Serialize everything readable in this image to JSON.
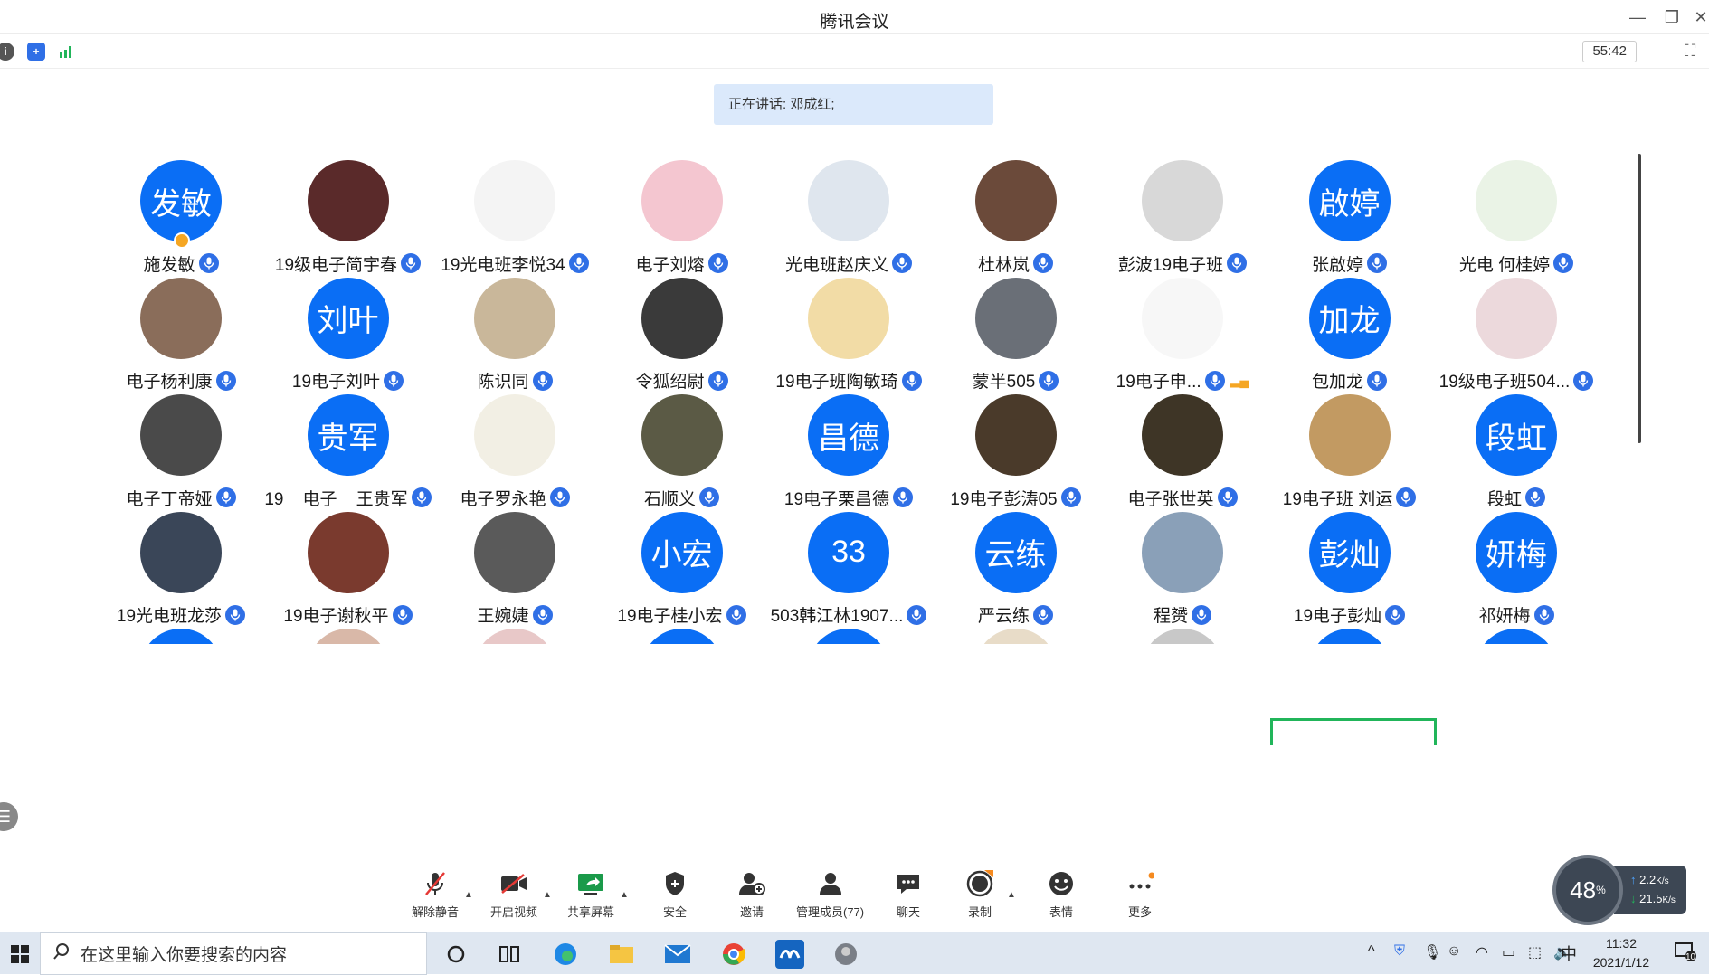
{
  "window": {
    "title": "腾讯会议"
  },
  "toolbar": {
    "timer": "55:42"
  },
  "speaking": {
    "text": "正在讲话: 邓成红;"
  },
  "participants": [
    {
      "name": "施发敏",
      "avatar_text": "发敏",
      "type": "text",
      "host": true
    },
    {
      "name": "19级电子简宇春",
      "type": "photo",
      "color": "#5a2a2a"
    },
    {
      "name": "19光电班李悦34",
      "type": "photo",
      "color": "#f4f4f4"
    },
    {
      "name": "电子刘熔",
      "type": "photo",
      "color": "#f4c6d0"
    },
    {
      "name": "光电班赵庆义",
      "type": "photo",
      "color": "#dfe6ee"
    },
    {
      "name": "杜林岚",
      "type": "photo",
      "color": "#6b4a3a"
    },
    {
      "name": "彭波19电子班",
      "type": "photo",
      "color": "#d8d8d8"
    },
    {
      "name": "张啟婷",
      "avatar_text": "啟婷",
      "type": "text"
    },
    {
      "name": "光电 何桂婷",
      "type": "photo",
      "color": "#eaf3e6"
    },
    {
      "name": "电子杨利康",
      "type": "photo",
      "color": "#8a6d5a"
    },
    {
      "name": "19电子刘叶",
      "avatar_text": "刘叶",
      "type": "text"
    },
    {
      "name": "陈识同",
      "type": "photo",
      "color": "#c9b79a"
    },
    {
      "name": "令狐绍尉",
      "type": "photo",
      "color": "#3a3a3a"
    },
    {
      "name": "19电子班陶敏琦",
      "type": "photo",
      "color": "#f2dca6"
    },
    {
      "name": "蒙半505",
      "type": "photo",
      "color": "#6a6f77"
    },
    {
      "name": "19电子申...",
      "type": "photo",
      "color": "#f7f7f7",
      "signal": true
    },
    {
      "name": "包加龙",
      "avatar_text": "加龙",
      "type": "text"
    },
    {
      "name": "19级电子班504...",
      "type": "photo",
      "color": "#ecd9dc"
    },
    {
      "name": "电子丁帝娅",
      "type": "photo",
      "color": "#4a4a4a"
    },
    {
      "name": "19    电子    王贵军",
      "avatar_text": "贵军",
      "type": "text"
    },
    {
      "name": "电子罗永艳",
      "type": "photo",
      "color": "#f2efe4"
    },
    {
      "name": "石顺义",
      "type": "photo",
      "color": "#5b5a45"
    },
    {
      "name": "19电子栗昌德",
      "avatar_text": "昌德",
      "type": "text"
    },
    {
      "name": "19电子彭涛05",
      "type": "photo",
      "color": "#4a3a2a"
    },
    {
      "name": "电子张世英",
      "type": "photo",
      "color": "#3e3526"
    },
    {
      "name": "19电子班 刘运",
      "type": "photo",
      "color": "#c29a62"
    },
    {
      "name": "段虹",
      "avatar_text": "段虹",
      "type": "text"
    },
    {
      "name": "19光电班龙莎",
      "type": "photo",
      "color": "#3a4658"
    },
    {
      "name": "19电子谢秋平",
      "type": "photo",
      "color": "#7a3a2e"
    },
    {
      "name": "王婉婕",
      "type": "photo",
      "color": "#5a5a5a"
    },
    {
      "name": "19电子桂小宏",
      "avatar_text": "小宏",
      "type": "text"
    },
    {
      "name": "503韩江林1907...",
      "avatar_text": "33",
      "type": "text"
    },
    {
      "name": "严云练",
      "avatar_text": "云练",
      "type": "text"
    },
    {
      "name": "程赟",
      "type": "photo",
      "color": "#8aa0b8"
    },
    {
      "name": "19电子彭灿",
      "avatar_text": "彭灿",
      "type": "text"
    },
    {
      "name": "祁妍梅",
      "avatar_text": "妍梅",
      "type": "text"
    }
  ],
  "partial_row": [
    {
      "type": "text"
    },
    {
      "type": "photo",
      "color": "#d9b8a8"
    },
    {
      "type": "photo",
      "color": "#e8c8c8"
    },
    {
      "type": "text"
    },
    {
      "type": "text"
    },
    {
      "type": "photo",
      "color": "#e8dcc8"
    },
    {
      "type": "photo",
      "color": "#c8c8c8"
    },
    {
      "type": "text"
    },
    {
      "type": "text"
    }
  ],
  "controls": {
    "unmute": "解除静音",
    "video": "开启视频",
    "share": "共享屏幕",
    "security": "安全",
    "invite": "邀请",
    "manage": "管理成员(77)",
    "chat": "聊天",
    "record": "录制",
    "reaction": "表情",
    "more": "更多"
  },
  "net": {
    "percent": "48",
    "up": "2.2",
    "down": "21.5",
    "unit": "K/s"
  },
  "taskbar": {
    "search_placeholder": "在这里输入你要搜索的内容",
    "ime": "中",
    "time": "11:32",
    "date": "2021/1/12",
    "notif_count": "10"
  },
  "colors": {
    "accent": "#0a6ef5",
    "mic": "#2f6fe6",
    "selected": "#21b55a"
  }
}
